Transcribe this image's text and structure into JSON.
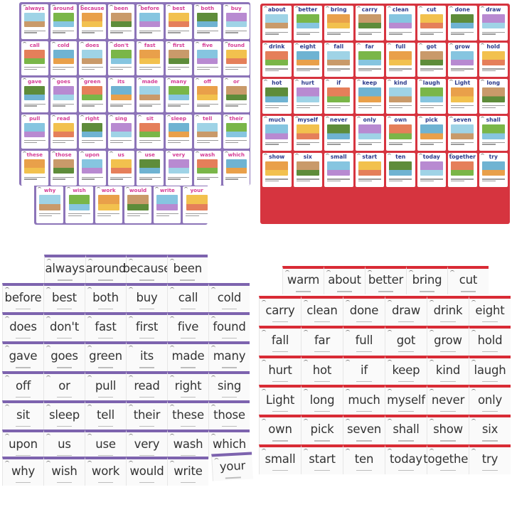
{
  "image": {
    "description": "Product photo of sight-word flashcards: purple and red picture cards (top) and matching word cards (bottom)",
    "colors": {
      "purple_board": "#8c74b8",
      "red_board": "#d6343f",
      "purple_word_text": "#d63c96",
      "red_word_text": "#2b3a8c",
      "word_card_text": "#333333"
    }
  },
  "purple_picture_cards": {
    "main_rows": [
      [
        "always",
        "around",
        "because",
        "been",
        "before",
        "best",
        "both",
        "buy"
      ],
      [
        "call",
        "cold",
        "does",
        "don't",
        "fast",
        "first",
        "five",
        "found"
      ],
      [
        "gave",
        "goes",
        "green",
        "its",
        "made",
        "many",
        "off",
        "or"
      ],
      [
        "pull",
        "read",
        "right",
        "sing",
        "sit",
        "sleep",
        "tell",
        "their"
      ],
      [
        "these",
        "those",
        "upon",
        "us",
        "use",
        "very",
        "wash",
        "which"
      ]
    ],
    "last_row": [
      "why",
      "wish",
      "work",
      "would",
      "write",
      "your"
    ]
  },
  "red_picture_cards": {
    "rows": [
      [
        "about",
        "better",
        "bring",
        "carry",
        "clean",
        "cut",
        "done",
        "draw"
      ],
      [
        "drink",
        "eight",
        "fall",
        "far",
        "full",
        "got",
        "grow",
        "hold"
      ],
      [
        "hot",
        "hurt",
        "if",
        "keep",
        "kind",
        "laugh",
        "Light",
        "long"
      ],
      [
        "much",
        "myself",
        "never",
        "only",
        "own",
        "pick",
        "seven",
        "shall"
      ],
      [
        "show",
        "six",
        "small",
        "start",
        "ten",
        "today",
        "together",
        "try"
      ]
    ]
  },
  "purple_word_cards": {
    "first_row": [
      "always",
      "around",
      "because",
      "been"
    ],
    "main_rows": [
      [
        "before",
        "best",
        "both",
        "buy",
        "call",
        "cold"
      ],
      [
        "does",
        "don't",
        "fast",
        "first",
        "five",
        "found"
      ],
      [
        "gave",
        "goes",
        "green",
        "its",
        "made",
        "many"
      ],
      [
        "off",
        "or",
        "pull",
        "read",
        "right",
        "sing"
      ],
      [
        "sit",
        "sleep",
        "tell",
        "their",
        "these",
        "those"
      ],
      [
        "upon",
        "us",
        "use",
        "very",
        "wash",
        "which"
      ]
    ],
    "last_row": [
      "why",
      "wish",
      "work",
      "would",
      "write"
    ],
    "tilted_card": "your"
  },
  "red_word_cards": {
    "first_row": [
      "warm",
      "about",
      "better",
      "bring",
      "cut"
    ],
    "main_rows": [
      [
        "carry",
        "clean",
        "done",
        "draw",
        "drink",
        "eight"
      ],
      [
        "fall",
        "far",
        "full",
        "got",
        "grow",
        "hold"
      ],
      [
        "hurt",
        "hot",
        "if",
        "keep",
        "kind",
        "laugh"
      ],
      [
        "Light",
        "long",
        "much",
        "myself",
        "never",
        "only"
      ],
      [
        "own",
        "pick",
        "seven",
        "shall",
        "show",
        "six"
      ],
      [
        "small",
        "start",
        "ten",
        "today",
        "together",
        "try"
      ]
    ]
  },
  "picture_palette": [
    "#9fd3e6",
    "#7ab648",
    "#e9a04a",
    "#c99a6a",
    "#86c5e0",
    "#f2c14e",
    "#5e8c3a",
    "#b88ad1",
    "#e57f5a",
    "#6fb3d2"
  ]
}
